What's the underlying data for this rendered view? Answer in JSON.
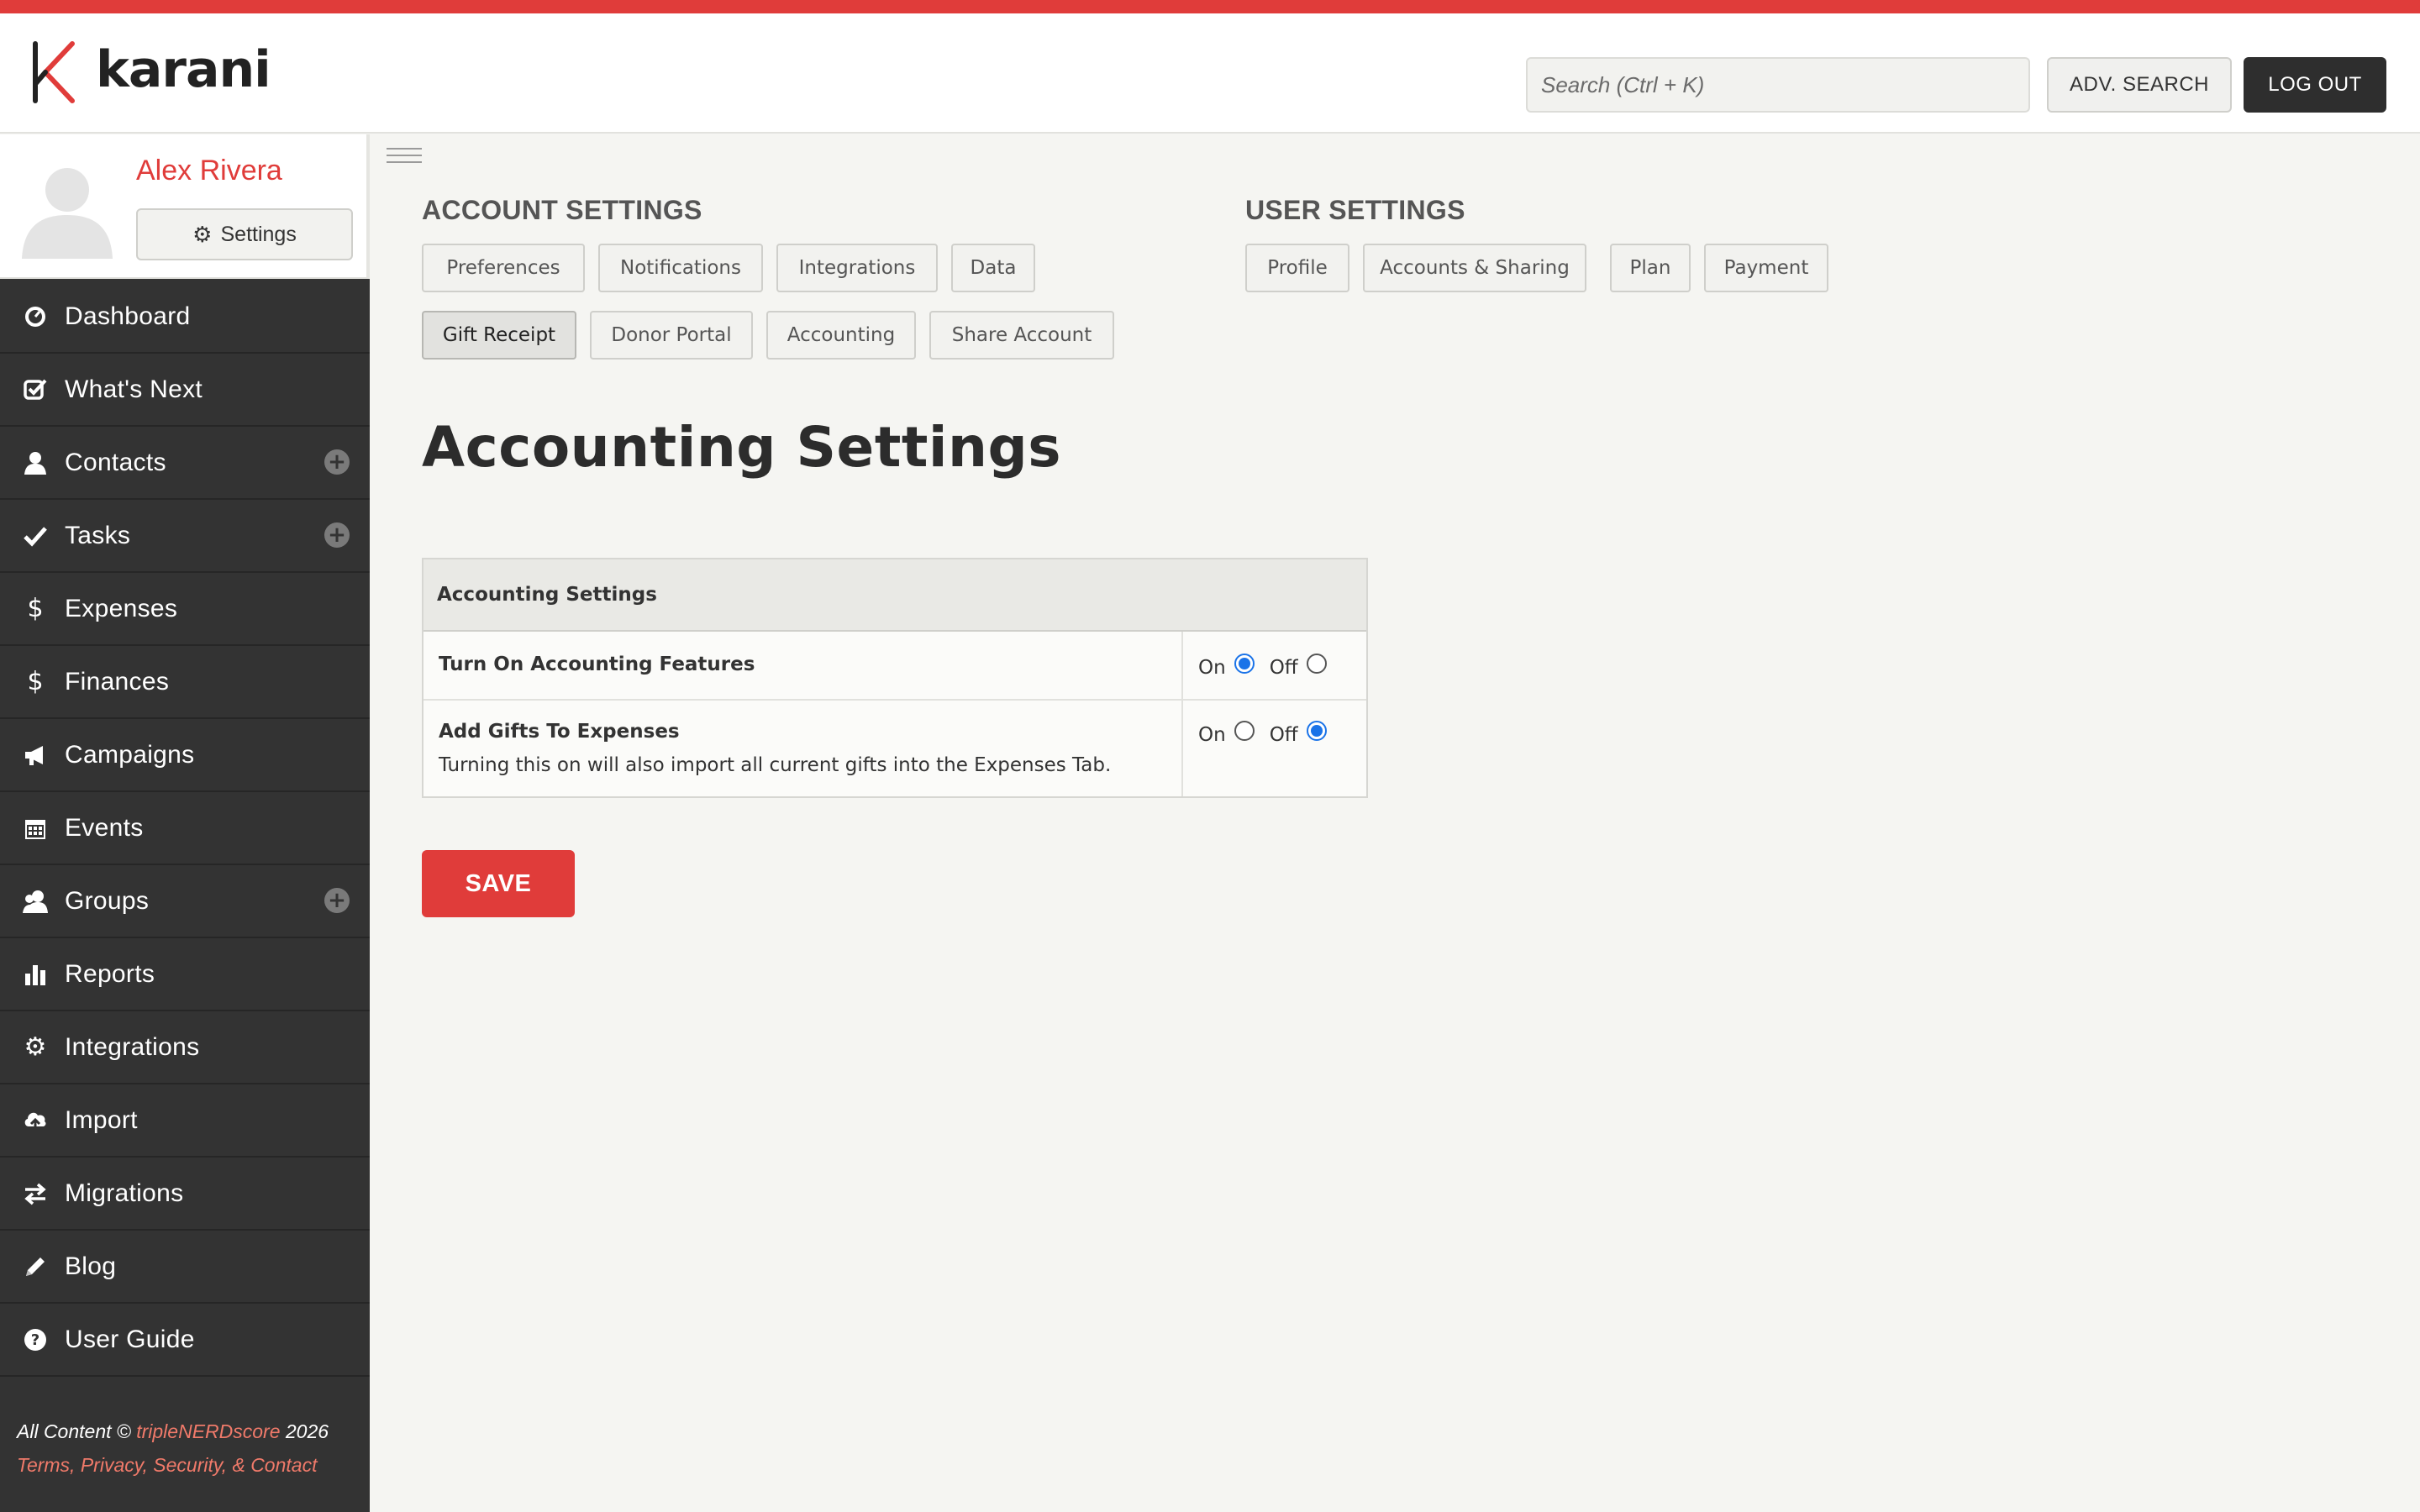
{
  "app": {
    "brand": "karani",
    "accent_color": "#e03c3a"
  },
  "header": {
    "search_placeholder": "Search (Ctrl + K)",
    "adv_search_label": "ADV. SEARCH",
    "logout_label": "LOG OUT"
  },
  "profile": {
    "name": "Alex Rivera",
    "settings_label": "Settings"
  },
  "sidebar": {
    "items": [
      {
        "label": "Dashboard",
        "icon": "dashboard-icon"
      },
      {
        "label": "What's Next",
        "icon": "checkbox-icon"
      },
      {
        "label": "Contacts",
        "icon": "user-icon",
        "has_add": true
      },
      {
        "label": "Tasks",
        "icon": "check-icon",
        "has_add": true
      },
      {
        "label": "Expenses",
        "icon": "dollar-icon"
      },
      {
        "label": "Finances",
        "icon": "dollar-icon"
      },
      {
        "label": "Campaigns",
        "icon": "megaphone-icon"
      },
      {
        "label": "Events",
        "icon": "calendar-icon"
      },
      {
        "label": "Groups",
        "icon": "users-icon",
        "has_add": true
      },
      {
        "label": "Reports",
        "icon": "bar-chart-icon"
      },
      {
        "label": "Integrations",
        "icon": "gear-icon"
      },
      {
        "label": "Import",
        "icon": "cloud-upload-icon"
      },
      {
        "label": "Migrations",
        "icon": "exchange-icon"
      },
      {
        "label": "Blog",
        "icon": "pencil-icon"
      },
      {
        "label": "User Guide",
        "icon": "question-icon"
      }
    ],
    "footer": {
      "line1_prefix": "All Content © ",
      "line1_link": "tripleNERDscore",
      "line1_suffix": " 2026",
      "line2": "Terms, Privacy, Security, & Contact"
    }
  },
  "account_settings": {
    "heading": "ACCOUNT SETTINGS",
    "tabs": [
      "Preferences",
      "Notifications",
      "Integrations",
      "Data",
      "Gift Receipt",
      "Donor Portal",
      "Accounting",
      "Share Account"
    ],
    "active_tab": "Gift Receipt"
  },
  "user_settings": {
    "heading": "USER SETTINGS",
    "tabs": [
      "Profile",
      "Accounts & Sharing",
      "Plan",
      "Payment"
    ]
  },
  "main": {
    "title": "Accounting Settings",
    "table": {
      "header": "Accounting Settings",
      "rows": [
        {
          "label": "Turn On Accounting Features",
          "description": "",
          "on_label": "On",
          "off_label": "Off",
          "value": "On"
        },
        {
          "label": "Add Gifts To Expenses",
          "description": "Turning this on will also import all current gifts into the Expenses Tab.",
          "on_label": "On",
          "off_label": "Off",
          "value": "Off"
        }
      ]
    },
    "save_label": "SAVE"
  }
}
